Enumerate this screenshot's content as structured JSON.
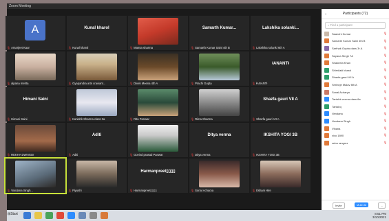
{
  "window": {
    "title": "Zoom Meeting"
  },
  "tiles": [
    {
      "big": "",
      "label": "Amarjeet Kaur",
      "kind": "avatar",
      "initial": "A"
    },
    {
      "big": "Kunal kharol",
      "label": "Kunal kharol",
      "kind": "name"
    },
    {
      "big": "",
      "label": "Mamta sharma",
      "kind": "photo",
      "cls": "p2"
    },
    {
      "big": "Samarth Kumar...",
      "label": "Samarth Kumar Saini 4th B",
      "kind": "name"
    },
    {
      "big": "Lakshika solanki...",
      "label": "Lakshika solanki 6th A",
      "kind": "name"
    },
    {
      "big": "",
      "label": "alpana mehta",
      "kind": "photo",
      "cls": "p7"
    },
    {
      "big": "",
      "label": "Gyapandra arts craviant...",
      "kind": "photo",
      "cls": "p3"
    },
    {
      "big": "",
      "label": "Divek Meena 4th A",
      "kind": "photo",
      "cls": "p4"
    },
    {
      "big": "",
      "label": "Prachi Gupta",
      "kind": "photo",
      "cls": "p5"
    },
    {
      "big": "ⱡANANTⱡ",
      "label": "ⱡANANTⱡ",
      "kind": "name"
    },
    {
      "big": "Himani Saini",
      "label": "Himani Saini",
      "kind": "name"
    },
    {
      "big": "",
      "label": "Kanishk Sharma class 3a",
      "kind": "photo",
      "cls": "p8"
    },
    {
      "big": "",
      "label": "Ritu Panwar",
      "kind": "photo",
      "cls": "p11"
    },
    {
      "big": "",
      "label": "Rima Sharma",
      "kind": "photo",
      "cls": "p6"
    },
    {
      "big": "Shazfa gauri VII A",
      "label": "Shazfa gauri VII A",
      "kind": "name"
    },
    {
      "big": "",
      "label": "REKHA DWIVEDI",
      "kind": "photo",
      "cls": "p9"
    },
    {
      "big": "Aditi",
      "label": "Aditi",
      "kind": "name"
    },
    {
      "big": "",
      "label": "Govind prasad Panwar",
      "kind": "photo",
      "cls": "p10"
    },
    {
      "big": "Ditya verma",
      "label": "Ditya verma",
      "kind": "name"
    },
    {
      "big": "IKSHITA YOGI 3B",
      "label": "IKSHITA YOGI 3B",
      "kind": "name"
    },
    {
      "big": "",
      "label": "Vandana Singh...",
      "kind": "photo",
      "cls": "p1",
      "active": true
    },
    {
      "big": "",
      "label": "Piyushi",
      "kind": "photo",
      "cls": "p12"
    },
    {
      "big": "Harmanpreet▯▯▯▯",
      "label": "Harmanpreet▯▯▯▯",
      "kind": "name"
    },
    {
      "big": "",
      "label": "Sonal Acharya",
      "kind": "photo",
      "cls": "p13"
    },
    {
      "big": "",
      "label": "Eshani Hire",
      "kind": "photo",
      "cls": "p14"
    }
  ],
  "participants_panel": {
    "title": "Participants (72)",
    "search_placeholder": "Find a participant",
    "items": [
      {
        "name": "Saanchi Kumar",
        "color": "#c9b8a8"
      },
      {
        "name": "Samarth Kumar Saini 4th B",
        "color": "#e07a3a"
      },
      {
        "name": "Sarthak Gupta class 3r A",
        "color": "#8a6aa8"
      },
      {
        "name": "Sayana Singh 7A",
        "color": "#e07a3a"
      },
      {
        "name": "Shakeela Khan",
        "color": "#e07a3a"
      },
      {
        "name": "Shirnilaki kharol",
        "color": "#2e9e6a"
      },
      {
        "name": "Shazfa gauri VII A",
        "color": "#2e9e6a"
      },
      {
        "name": "Shrinnje Malav 8th A",
        "color": "#e07a3a"
      },
      {
        "name": "Sonal Acharya",
        "color": "#c97a6a"
      },
      {
        "name": "Tanishk verma class 6a",
        "color": "#2d8cff"
      },
      {
        "name": "Tanishq",
        "color": "#2e9e6a"
      },
      {
        "name": "Vandana",
        "color": "#2d8cff"
      },
      {
        "name": "Vandana Singh",
        "color": "#2d8cff"
      },
      {
        "name": "Vihana",
        "color": "#e07a3a"
      },
      {
        "name": "vivo 1890",
        "color": "#e07a3a"
      },
      {
        "name": "zeba rangrez",
        "color": "#e07a3a"
      }
    ],
    "invite_label": "Invite",
    "mute_all_label": "Mute All",
    "more_label": "..."
  },
  "taskbar": {
    "start_label": "Start",
    "time": "8:51 PM",
    "date": "3/10/2021"
  }
}
